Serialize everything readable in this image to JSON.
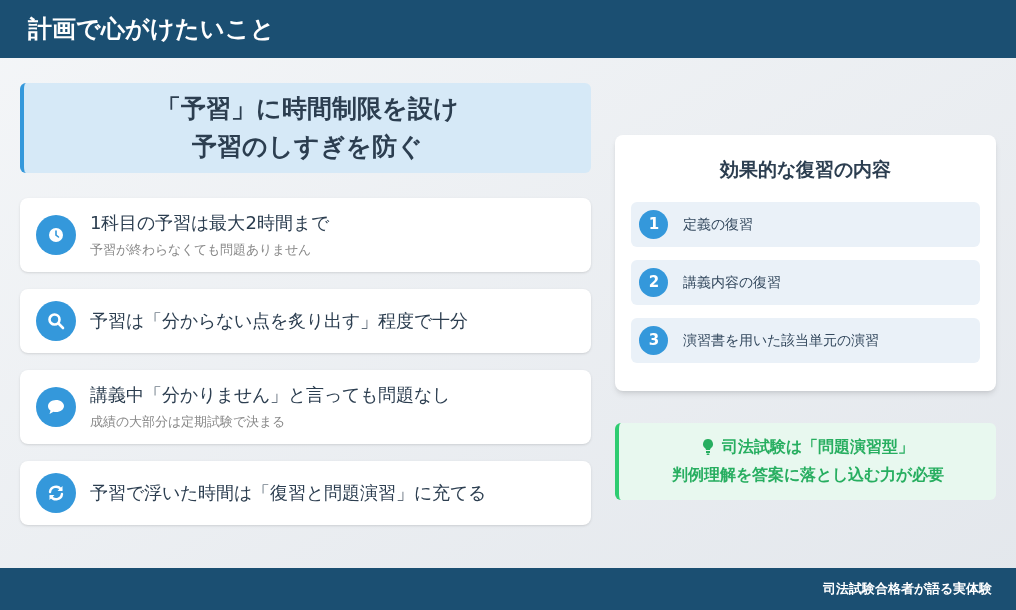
{
  "header": {
    "title": "計画で心がけたいこと"
  },
  "headline": {
    "lines": [
      "「予習」に時間制限を設け",
      "予習のしすぎを防ぐ"
    ]
  },
  "points": [
    {
      "text": "1科目の予習は最大2時間まで",
      "note": "予習が終わらなくても問題ありません"
    },
    {
      "text": "予習は「分からない点を炙り出す」程度で十分"
    },
    {
      "text": "講義中「分かりません」と言っても問題なし",
      "note": "成績の大部分は定期試験で決まる"
    },
    {
      "text": "予習で浮いた時間は「復習と問題演習」に充てる"
    }
  ],
  "review": {
    "title": "効果的な復習の内容",
    "items": [
      {
        "number": "1",
        "text": "定義の復習"
      },
      {
        "number": "2",
        "text": "講義内容の復習"
      },
      {
        "number": "3",
        "text": "演習書を用いた該当単元の演習"
      }
    ]
  },
  "tip": {
    "lines": [
      "司法試験は「問題演習型」",
      "判例理解を答案に落とし込む力が必要"
    ]
  },
  "footer": {
    "text": "司法試験合格者が語る実体験"
  }
}
